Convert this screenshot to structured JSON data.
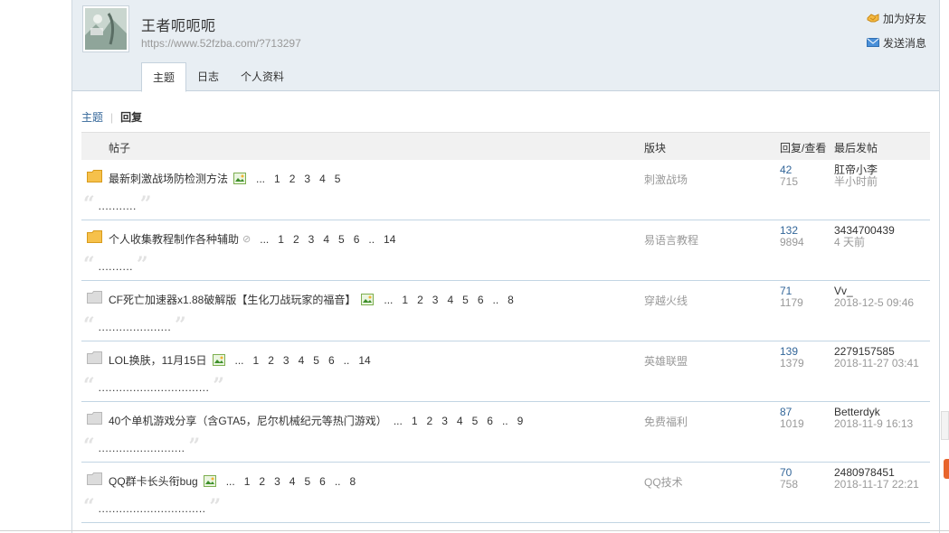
{
  "user": {
    "name": "王者呃呃呃",
    "url": "https://www.52fzba.com/?713297",
    "avatar_icon": "avatar-image"
  },
  "actions": {
    "add_friend": "加为好友",
    "send_message": "发送消息"
  },
  "tabs": [
    {
      "label": "主题"
    },
    {
      "label": "日志"
    },
    {
      "label": "个人资料"
    }
  ],
  "subnav": {
    "topics": "主题",
    "separator": "|",
    "replies": "回复"
  },
  "table": {
    "headers": {
      "post": "帖子",
      "forum": "版块",
      "reply_view": "回复/查看",
      "last_post": "最后发帖"
    },
    "rows": [
      {
        "title": "最新刺激战场防检测方法",
        "icon": "folder-hot-icon",
        "has_pic": true,
        "has_attach": false,
        "pages": [
          "...",
          "1",
          "2",
          "3",
          "4",
          "5"
        ],
        "forum": "刺激战场",
        "replies": "42",
        "views": "715",
        "last_user": "肛帝小李",
        "last_time": "半小时前",
        "quote": "..........."
      },
      {
        "title": "个人收集教程制作各种辅助",
        "icon": "folder-hot-icon",
        "has_pic": false,
        "has_attach": true,
        "pages": [
          "...",
          "1",
          "2",
          "3",
          "4",
          "5",
          "6",
          "..",
          "14"
        ],
        "forum": "易语言教程",
        "replies": "132",
        "views": "9894",
        "last_user": "3434700439",
        "last_time": "4 天前",
        "quote": ".........."
      },
      {
        "title": "CF死亡加速器x1.88破解版【生化刀战玩家的福音】",
        "icon": "folder-normal-icon",
        "has_pic": true,
        "has_attach": false,
        "pages": [
          "...",
          "1",
          "2",
          "3",
          "4",
          "5",
          "6",
          "..",
          "8"
        ],
        "forum": "穿越火线",
        "replies": "71",
        "views": "1179",
        "last_user": "Vv_",
        "last_time": "2018-12-5 09:46",
        "quote": "....................."
      },
      {
        "title": "LOL换肤，11月15日",
        "icon": "folder-normal-icon",
        "has_pic": true,
        "has_attach": false,
        "pages": [
          "...",
          "1",
          "2",
          "3",
          "4",
          "5",
          "6",
          "..",
          "14"
        ],
        "forum": "英雄联盟",
        "replies": "139",
        "views": "1379",
        "last_user": "2279157585",
        "last_time": "2018-11-27 03:41",
        "quote": "................................"
      },
      {
        "title": "40个单机游戏分享（含GTA5，尼尔机械纪元等热门游戏）",
        "icon": "folder-normal-icon",
        "has_pic": false,
        "has_attach": false,
        "pages": [
          "...",
          "1",
          "2",
          "3",
          "4",
          "5",
          "6",
          "..",
          "9"
        ],
        "forum": "免费福利",
        "replies": "87",
        "views": "1019",
        "last_user": "Betterdyk",
        "last_time": "2018-11-9 16:13",
        "quote": "........................."
      },
      {
        "title": "QQ群卡长头衔bug",
        "icon": "folder-normal-icon",
        "has_pic": true,
        "has_attach": false,
        "pages": [
          "...",
          "1",
          "2",
          "3",
          "4",
          "5",
          "6",
          "..",
          "8"
        ],
        "forum": "QQ技术",
        "replies": "70",
        "views": "758",
        "last_user": "2480978451",
        "last_time": "2018-11-17 22:21",
        "quote": "..............................."
      }
    ]
  },
  "colors": {
    "header_bg": "#e8eef3",
    "link_blue": "#336699",
    "folder_hot": "#f6c14b",
    "folder_normal": "#dcdcdc",
    "row_border": "#c2d5e3"
  }
}
